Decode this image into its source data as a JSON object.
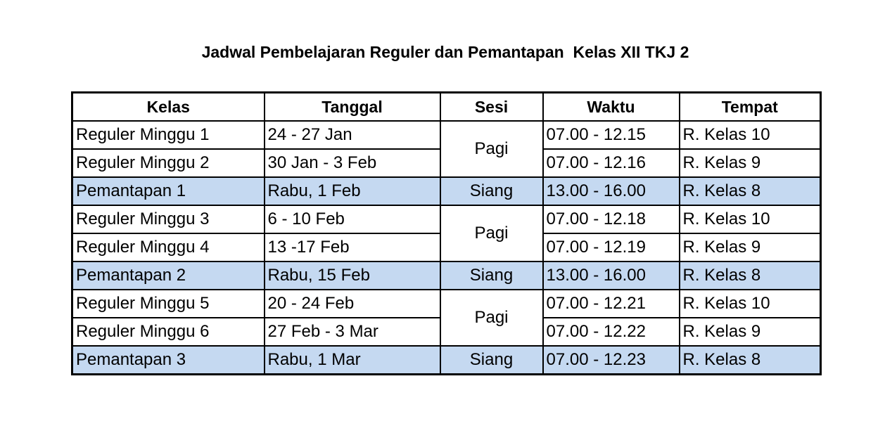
{
  "title": "Jadwal Pembelajaran Reguler dan Pemantapan  Kelas XII TKJ 2",
  "colors": {
    "highlight_row": "#c5d9f1",
    "border": "#000000"
  },
  "columns": [
    "Kelas",
    "Tanggal",
    "Sesi",
    "Waktu",
    "Tempat"
  ],
  "rows": [
    {
      "kelas": "Reguler Minggu 1",
      "tanggal": "24 - 27 Jan",
      "sesi": "Pagi",
      "waktu": "07.00 - 12.15",
      "tempat": "R. Kelas 10",
      "highlight": false
    },
    {
      "kelas": "Reguler Minggu 2",
      "tanggal": "30 Jan - 3 Feb",
      "sesi": "Pagi",
      "waktu": "07.00 - 12.16",
      "tempat": "R. Kelas 9",
      "highlight": false
    },
    {
      "kelas": "Pemantapan 1",
      "tanggal": "Rabu,  1 Feb",
      "sesi": "Siang",
      "waktu": "13.00 - 16.00",
      "tempat": "R. Kelas 8",
      "highlight": true
    },
    {
      "kelas": "Reguler Minggu 3",
      "tanggal": "6 - 10 Feb",
      "sesi": "Pagi",
      "waktu": "07.00 - 12.18",
      "tempat": "R. Kelas 10",
      "highlight": false
    },
    {
      "kelas": "Reguler Minggu 4",
      "tanggal": "13 -17 Feb",
      "sesi": "Pagi",
      "waktu": "07.00 - 12.19",
      "tempat": "R. Kelas 9",
      "highlight": false
    },
    {
      "kelas": "Pemantapan 2",
      "tanggal": "Rabu,  15 Feb",
      "sesi": "Siang",
      "waktu": "13.00 - 16.00",
      "tempat": "R. Kelas 8",
      "highlight": true
    },
    {
      "kelas": "Reguler Minggu 5",
      "tanggal": "20 - 24 Feb",
      "sesi": "Pagi",
      "waktu": "07.00 - 12.21",
      "tempat": "R. Kelas 10",
      "highlight": false
    },
    {
      "kelas": "Reguler Minggu 6",
      "tanggal": "27 Feb - 3 Mar",
      "sesi": "Pagi",
      "waktu": "07.00 - 12.22",
      "tempat": "R. Kelas 9",
      "highlight": false
    },
    {
      "kelas": "Pemantapan 3",
      "tanggal": "Rabu,  1 Mar",
      "sesi": "Siang",
      "waktu": "07.00 - 12.23",
      "tempat": "R. Kelas 8",
      "highlight": true
    }
  ]
}
